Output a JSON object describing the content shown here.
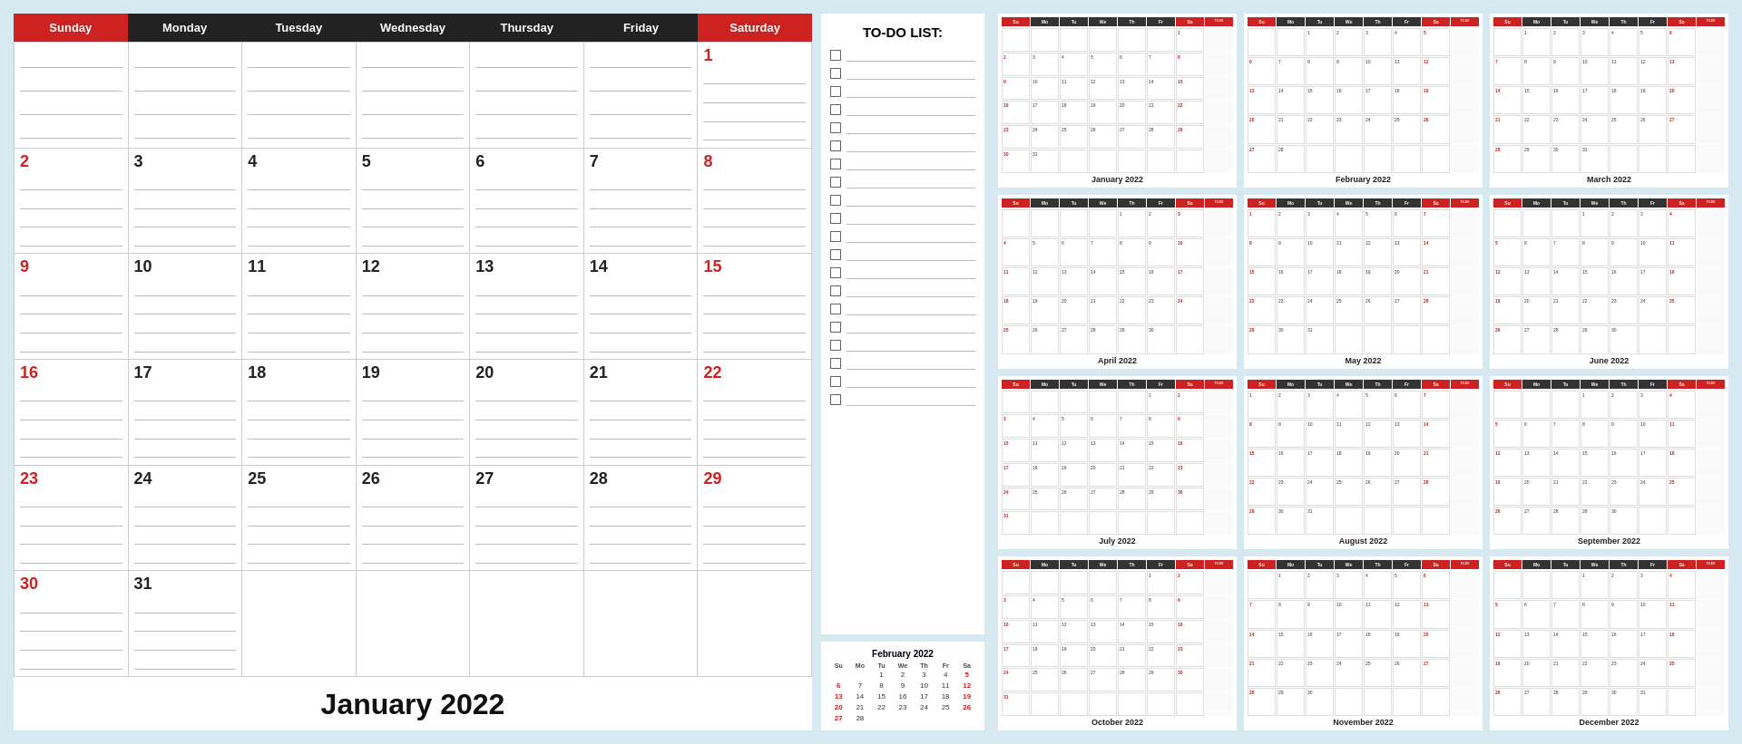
{
  "main_calendar": {
    "title": "January 2022",
    "days": [
      "Sunday",
      "Monday",
      "Tuesday",
      "Wednesday",
      "Thursday",
      "Friday",
      "Saturday"
    ],
    "weeks": [
      [
        {
          "num": "",
          "red": false,
          "empty": true
        },
        {
          "num": "",
          "red": false,
          "empty": true
        },
        {
          "num": "",
          "red": false,
          "empty": true
        },
        {
          "num": "",
          "red": false,
          "empty": true
        },
        {
          "num": "",
          "red": false,
          "empty": true
        },
        {
          "num": "",
          "red": false,
          "empty": true
        },
        {
          "num": "1",
          "red": true,
          "empty": false
        }
      ],
      [
        {
          "num": "2",
          "red": true,
          "empty": false
        },
        {
          "num": "3",
          "red": false,
          "empty": false
        },
        {
          "num": "4",
          "red": false,
          "empty": false
        },
        {
          "num": "5",
          "red": false,
          "empty": false
        },
        {
          "num": "6",
          "red": false,
          "empty": false
        },
        {
          "num": "7",
          "red": false,
          "empty": false
        },
        {
          "num": "8",
          "red": true,
          "empty": false
        }
      ],
      [
        {
          "num": "9",
          "red": true,
          "empty": false
        },
        {
          "num": "10",
          "red": false,
          "empty": false
        },
        {
          "num": "11",
          "red": false,
          "empty": false
        },
        {
          "num": "12",
          "red": false,
          "empty": false
        },
        {
          "num": "13",
          "red": false,
          "empty": false
        },
        {
          "num": "14",
          "red": false,
          "empty": false
        },
        {
          "num": "15",
          "red": true,
          "empty": false
        }
      ],
      [
        {
          "num": "16",
          "red": true,
          "empty": false
        },
        {
          "num": "17",
          "red": false,
          "empty": false
        },
        {
          "num": "18",
          "red": false,
          "empty": false
        },
        {
          "num": "19",
          "red": false,
          "empty": false
        },
        {
          "num": "20",
          "red": false,
          "empty": false
        },
        {
          "num": "21",
          "red": false,
          "empty": false
        },
        {
          "num": "22",
          "red": true,
          "empty": false
        }
      ],
      [
        {
          "num": "23",
          "red": true,
          "empty": false
        },
        {
          "num": "24",
          "red": false,
          "empty": false
        },
        {
          "num": "25",
          "red": false,
          "empty": false
        },
        {
          "num": "26",
          "red": false,
          "empty": false
        },
        {
          "num": "27",
          "red": false,
          "empty": false
        },
        {
          "num": "28",
          "red": false,
          "empty": false
        },
        {
          "num": "29",
          "red": true,
          "empty": false
        }
      ],
      [
        {
          "num": "30",
          "red": true,
          "empty": false
        },
        {
          "num": "31",
          "red": false,
          "empty": false
        },
        {
          "num": "",
          "red": false,
          "empty": true
        },
        {
          "num": "",
          "red": false,
          "empty": true
        },
        {
          "num": "",
          "red": false,
          "empty": true
        },
        {
          "num": "",
          "red": false,
          "empty": true
        },
        {
          "num": "",
          "red": false,
          "empty": true
        }
      ]
    ]
  },
  "todo": {
    "title": "TO-DO LIST:",
    "items_count": 20
  },
  "feb_mini": {
    "title": "February 2022",
    "headers": [
      "Su",
      "Mo",
      "Tu",
      "We",
      "Th",
      "Fr",
      "Sa"
    ],
    "rows": [
      [
        "",
        "",
        "1",
        "2",
        "3",
        "4",
        "5"
      ],
      [
        "6",
        "7",
        "8",
        "9",
        "10",
        "11",
        "12"
      ],
      [
        "13",
        "14",
        "15",
        "16",
        "17",
        "18",
        "19"
      ],
      [
        "20",
        "21",
        "22",
        "23",
        "24",
        "25",
        "26"
      ],
      [
        "27",
        "28",
        "",
        "",
        "",
        "",
        ""
      ]
    ],
    "red_days": [
      "6",
      "13",
      "20",
      "27",
      "5",
      "12",
      "19",
      "26"
    ]
  },
  "months": [
    {
      "label": "January 2022",
      "cols": [
        "Su",
        "Mo",
        "Tu",
        "We",
        "Th",
        "Fr",
        "Sa",
        "TO-DO LIST"
      ]
    },
    {
      "label": "February 2022",
      "cols": [
        "Su",
        "Mo",
        "Tu",
        "We",
        "Th",
        "Fr",
        "Sa",
        "TO-DO LIST"
      ]
    },
    {
      "label": "March 2022",
      "cols": [
        "Su",
        "Mo",
        "Tu",
        "We",
        "Th",
        "Fr",
        "Sa",
        "TO-DO LIST"
      ]
    },
    {
      "label": "April 2022",
      "cols": [
        "Su",
        "Mo",
        "Tu",
        "We",
        "Th",
        "Fr",
        "Sa",
        "TO-DO LIST"
      ]
    },
    {
      "label": "May 2022",
      "cols": [
        "Su",
        "Mo",
        "Tu",
        "We",
        "Th",
        "Fr",
        "Sa",
        "TO-DO LIST"
      ]
    },
    {
      "label": "June 2022",
      "cols": [
        "Su",
        "Mo",
        "Tu",
        "We",
        "Th",
        "Fr",
        "Sa",
        "TO-DO LIST"
      ]
    },
    {
      "label": "July 2022",
      "cols": [
        "Su",
        "Mo",
        "Tu",
        "We",
        "Th",
        "Fr",
        "Sa",
        "TO-DO LIST"
      ]
    },
    {
      "label": "August 2022",
      "cols": [
        "Su",
        "Mo",
        "Tu",
        "We",
        "Th",
        "Fr",
        "Sa",
        "TO-DO LIST"
      ]
    },
    {
      "label": "September 2022",
      "cols": [
        "Su",
        "Mo",
        "Tu",
        "We",
        "Th",
        "Fr",
        "Sa",
        "TO-DO LIST"
      ]
    },
    {
      "label": "October 2022",
      "cols": [
        "Su",
        "Mo",
        "Tu",
        "We",
        "Th",
        "Fr",
        "Sa",
        "TO-DO LIST"
      ]
    },
    {
      "label": "November 2022",
      "cols": [
        "Su",
        "Mo",
        "Tu",
        "We",
        "Th",
        "Fr",
        "Sa",
        "TO-DO LIST"
      ]
    },
    {
      "label": "December 2022",
      "cols": [
        "Su",
        "Mo",
        "Tu",
        "We",
        "Th",
        "Fr",
        "Sa",
        "TO-DO LIST"
      ]
    }
  ]
}
